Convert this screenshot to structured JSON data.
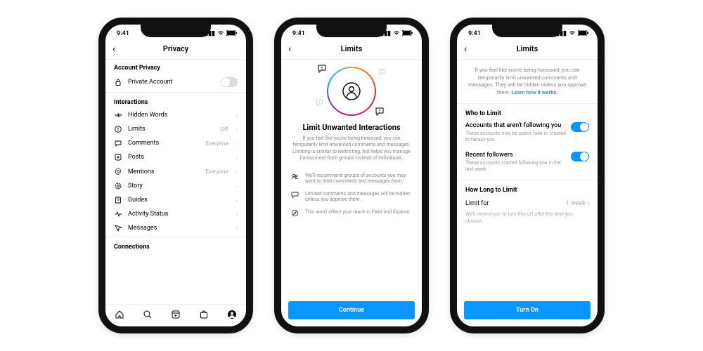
{
  "status": {
    "time": "9:41"
  },
  "screen1": {
    "title": "Privacy",
    "sections": {
      "accountPrivacy": "Account Privacy",
      "interactions": "Interactions",
      "connections": "Connections"
    },
    "privateAccount": "Private Account",
    "rows": {
      "hiddenWords": "Hidden Words",
      "limits": {
        "label": "Limits",
        "value": "Off"
      },
      "comments": {
        "label": "Comments",
        "value": "Everyone"
      },
      "posts": "Posts",
      "mentions": {
        "label": "Mentions",
        "value": "Everyone"
      },
      "story": "Story",
      "guides": "Guides",
      "activityStatus": "Activity Status",
      "messages": "Messages"
    }
  },
  "screen2": {
    "title": "Limits",
    "heading": "Limit Unwanted Interactions",
    "body": "If you feel like you're being harassed, you can temporarily limit unwanted comments and messages. Limiting is similar to restricting, but helps you manage harassment from groups instead of individuals.",
    "bullets": [
      "We'll recommend groups of accounts you may want to limit comments and messages from.",
      "Limited comments and messages will be hidden unless you approve them.",
      "This won't affect your reach in Feed and Explore."
    ],
    "cta": "Continue"
  },
  "screen3": {
    "title": "Limits",
    "intro": "If you feel like you're being harassed, you can temporarily limit unwanted comments and messages. They will be hidden unless you approve them.",
    "learn": "Learn how it works.",
    "whoHead": "Who to Limit",
    "opt1": {
      "title": "Accounts that aren't following you",
      "desc": "These accounts may be spam, fake or created to harass you."
    },
    "opt2": {
      "title": "Recent followers",
      "desc": "These accounts started following you in the last week."
    },
    "howHead": "How Long to Limit",
    "limitFor": {
      "label": "Limit for",
      "value": "1 week"
    },
    "reminder": "We'll remind you to turn this off after the time you choose.",
    "cta": "Turn On"
  }
}
